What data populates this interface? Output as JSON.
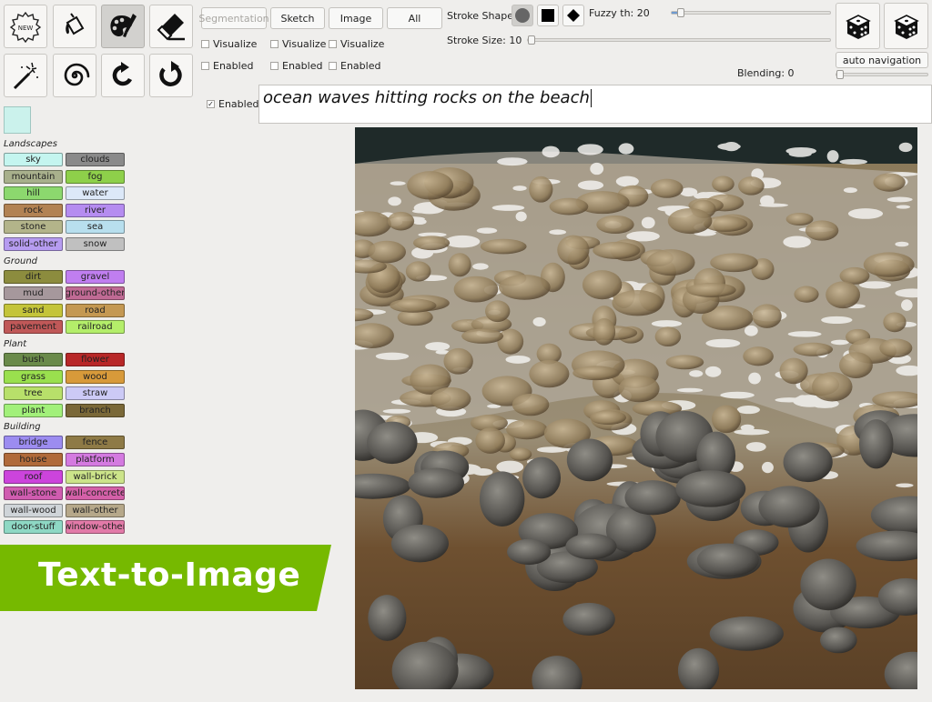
{
  "toolbar": {
    "tools": [
      {
        "id": "new",
        "icon": "new-badge-icon",
        "label": "NEW"
      },
      {
        "id": "fill",
        "icon": "paint-bucket-icon"
      },
      {
        "id": "palette",
        "icon": "palette-brush-icon",
        "active": true
      },
      {
        "id": "eraser",
        "icon": "eraser-icon"
      },
      {
        "id": "wand",
        "icon": "magic-wand-icon"
      },
      {
        "id": "spiral",
        "icon": "spiral-icon"
      },
      {
        "id": "undo",
        "icon": "undo-icon"
      },
      {
        "id": "redo",
        "icon": "redo-icon"
      }
    ]
  },
  "view": {
    "segmentation_label": "Segmentation",
    "sketch_label": "Sketch",
    "image_label": "Image",
    "all_label": "All",
    "visualize_label": "Visualize",
    "enabled_label": "Enabled"
  },
  "stroke": {
    "shape_label": "Stroke Shape",
    "size_label": "Stroke Size: 10",
    "fuzzy_label": "Fuzzy th: 20",
    "shapes": [
      "circle-icon",
      "square-icon",
      "diamond-icon"
    ]
  },
  "blending": {
    "label": "Blending: 0",
    "value": 0
  },
  "navigation": {
    "auto_label": "auto navigation",
    "dice_icon": "dice-icon"
  },
  "text_prompt": {
    "enabled_label": "Enabled",
    "enabled": true,
    "value": "ocean waves hitting rocks on the beach"
  },
  "palette": {
    "current_color": "#cbf2ec",
    "categories": [
      {
        "name": "Landscapes",
        "items": [
          {
            "label": "sky",
            "color": "#c4f5ef"
          },
          {
            "label": "clouds",
            "color": "#8a8a8a"
          },
          {
            "label": "mountain",
            "color": "#a8b08c"
          },
          {
            "label": "fog",
            "color": "#8ed04a"
          },
          {
            "label": "hill",
            "color": "#8cd86e"
          },
          {
            "label": "water",
            "color": "#dce8f8"
          },
          {
            "label": "rock",
            "color": "#b28253"
          },
          {
            "label": "river",
            "color": "#b58cf0"
          },
          {
            "label": "stone",
            "color": "#b3b48a"
          },
          {
            "label": "sea",
            "color": "#b8dfee"
          },
          {
            "label": "solid-other",
            "color": "#b69cf0"
          },
          {
            "label": "snow",
            "color": "#c0c0c0"
          }
        ]
      },
      {
        "name": "Ground",
        "items": [
          {
            "label": "dirt",
            "color": "#8c8c3e"
          },
          {
            "label": "gravel",
            "color": "#c07ef0"
          },
          {
            "label": "mud",
            "color": "#a6989c"
          },
          {
            "label": "ground-other",
            "color": "#c06a94"
          },
          {
            "label": "sand",
            "color": "#c4c43a"
          },
          {
            "label": "road",
            "color": "#c49852"
          },
          {
            "label": "pavement",
            "color": "#c05858"
          },
          {
            "label": "railroad",
            "color": "#b4ee6a"
          }
        ]
      },
      {
        "name": "Plant",
        "items": [
          {
            "label": "bush",
            "color": "#6a8a4a"
          },
          {
            "label": "flower",
            "color": "#b82828"
          },
          {
            "label": "grass",
            "color": "#9ae04e"
          },
          {
            "label": "wood",
            "color": "#d89a3a"
          },
          {
            "label": "tree",
            "color": "#b8e06a"
          },
          {
            "label": "straw",
            "color": "#cccaf6"
          },
          {
            "label": "plant",
            "color": "#a2f07a"
          },
          {
            "label": "branch",
            "color": "#7a6838"
          }
        ]
      },
      {
        "name": "Building",
        "items": [
          {
            "label": "bridge",
            "color": "#9c8cf0"
          },
          {
            "label": "fence",
            "color": "#8e7a46"
          },
          {
            "label": "house",
            "color": "#b06a3a"
          },
          {
            "label": "platform",
            "color": "#d47ae0"
          },
          {
            "label": "roof",
            "color": "#cc44dc"
          },
          {
            "label": "wall-brick",
            "color": "#cce48a"
          },
          {
            "label": "wall-stone",
            "color": "#d05cb0"
          },
          {
            "label": "wall-concrete",
            "color": "#d460a8"
          },
          {
            "label": "wall-wood",
            "color": "#cfd4d8"
          },
          {
            "label": "wall-other",
            "color": "#b6a88a"
          },
          {
            "label": "door-stuff",
            "color": "#8ed8c4"
          },
          {
            "label": "window-other",
            "color": "#e27aa8"
          }
        ]
      }
    ]
  },
  "banner": {
    "text": "Text-to-Image",
    "color": "#76b900"
  },
  "output_image": {
    "icon": "generated-beach-image"
  }
}
